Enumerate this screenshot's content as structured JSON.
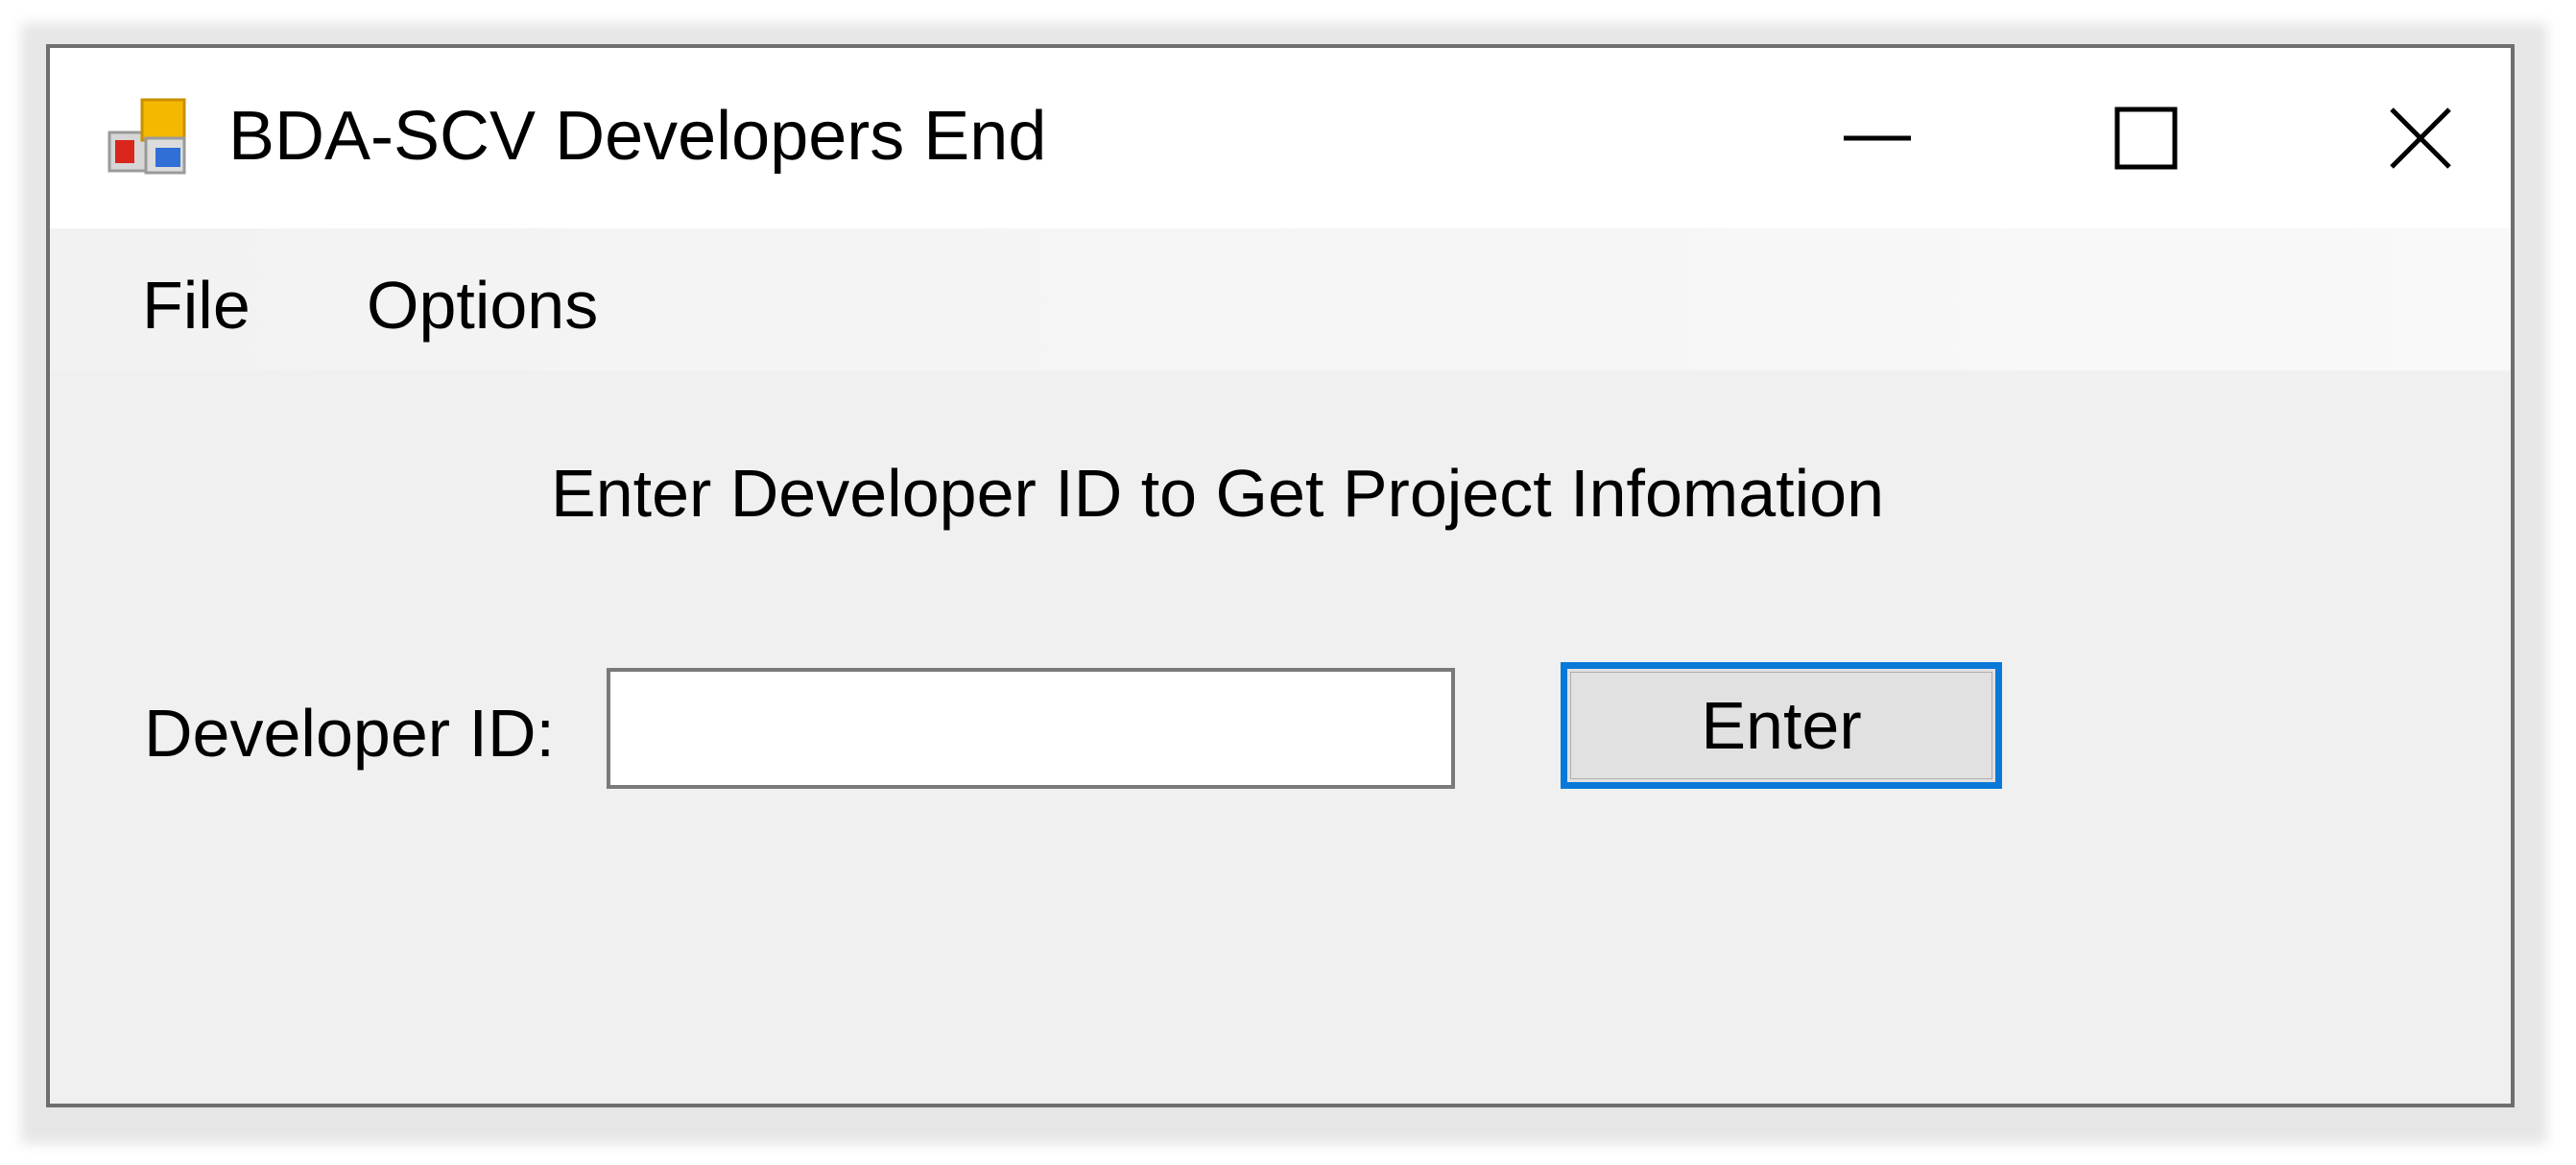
{
  "window": {
    "title": "BDA-SCV Developers End",
    "icon": "app-icon",
    "caption_buttons": [
      "minimize-icon",
      "maximize-icon",
      "close-icon"
    ]
  },
  "menubar": {
    "items": [
      {
        "label": "File"
      },
      {
        "label": "Options"
      }
    ]
  },
  "main": {
    "heading": "Enter Developer ID to Get Project Infomation",
    "developer_id": {
      "label": "Developer ID:",
      "value": "",
      "placeholder": ""
    },
    "enter_button": {
      "label": "Enter",
      "focus_color": "#0a78d7"
    }
  },
  "colors": {
    "window_background": "#f0f0f0",
    "titlebar_background": "#ffffff",
    "button_background": "#e1e1e1",
    "accent": "#0a78d7"
  }
}
